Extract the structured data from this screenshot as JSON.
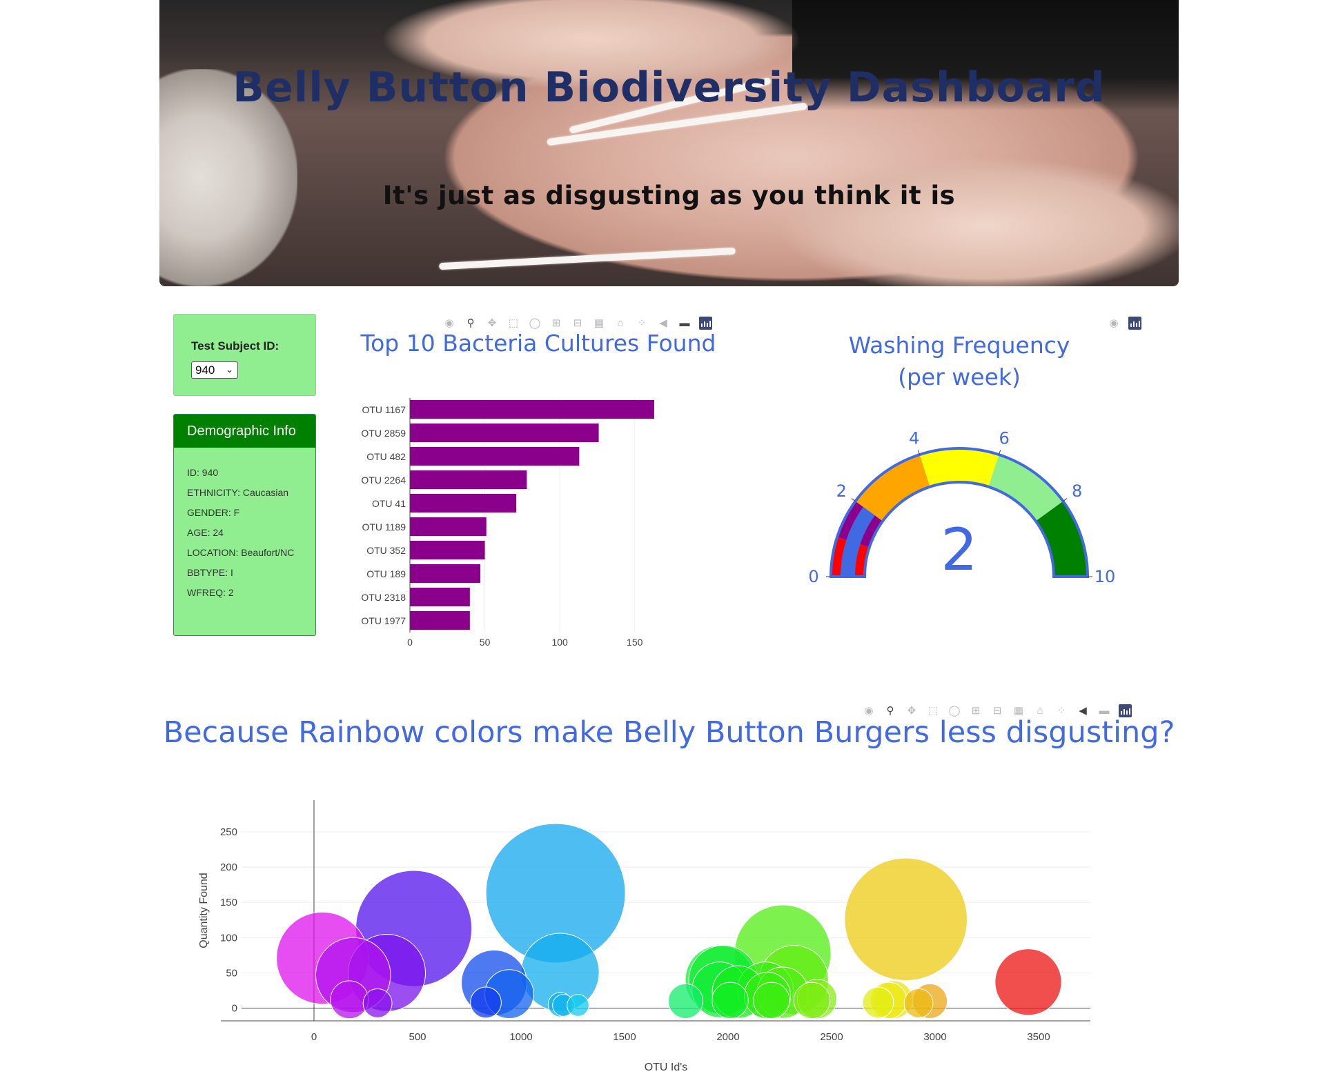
{
  "hero": {
    "title": "Belly Button Biodiversity Dashboard",
    "subtitle": "It's just as disgusting as you think it is"
  },
  "selector": {
    "label": "Test Subject ID:",
    "selected": "940"
  },
  "demographics": {
    "header": "Demographic Info",
    "lines": [
      "ID: 940",
      "ETHNICITY: Caucasian",
      "GENDER: F",
      "AGE: 24",
      "LOCATION: Beaufort/NC",
      "BBTYPE: I",
      "WFREQ: 2"
    ]
  },
  "colors": {
    "title_blue": "#4169e1",
    "bar": "#8b008b",
    "panel_green": "#90ee90",
    "header_green": "#008000"
  },
  "chart_data": [
    {
      "type": "bar",
      "orientation": "horizontal",
      "title": "Top 10 Bacteria Cultures Found",
      "categories": [
        "OTU 1167",
        "OTU 2859",
        "OTU 482",
        "OTU 2264",
        "OTU 41",
        "OTU 1189",
        "OTU 352",
        "OTU 189",
        "OTU 2318",
        "OTU 1977"
      ],
      "values": [
        163,
        126,
        113,
        78,
        71,
        51,
        50,
        47,
        40,
        40
      ],
      "xlim": [
        0,
        175
      ],
      "xticks": [
        0,
        50,
        100,
        150
      ],
      "grid": true,
      "color": "#8b008b"
    },
    {
      "type": "gauge",
      "title_lines": [
        "Washing Frequency",
        "(per week)"
      ],
      "value": 2,
      "range": [
        0,
        10
      ],
      "ticks": [
        0,
        2,
        4,
        6,
        8,
        10
      ],
      "steps": [
        {
          "range": [
            0,
            1
          ],
          "color": "#ff0000"
        },
        {
          "range": [
            1,
            2
          ],
          "color": "#8b008b"
        },
        {
          "range": [
            2,
            4
          ],
          "color": "#ffa500"
        },
        {
          "range": [
            4,
            6
          ],
          "color": "#ffff00"
        },
        {
          "range": [
            6,
            8
          ],
          "color": "#90ee90"
        },
        {
          "range": [
            8,
            10
          ],
          "color": "#008000"
        }
      ],
      "bar_color": "#4169e1"
    },
    {
      "type": "scatter",
      "mode": "bubble",
      "title": "Because Rainbow colors make Belly Button Burgers less disgusting?",
      "xlabel": "OTU Id's",
      "ylabel": "Quantity Found",
      "xlim": [
        -350,
        3750
      ],
      "ylim": [
        -18,
        295
      ],
      "xticks": [
        0,
        500,
        1000,
        1500,
        2000,
        2500,
        3000,
        3500
      ],
      "yticks": [
        0,
        50,
        100,
        150,
        200,
        250
      ],
      "grid": true,
      "points": [
        {
          "x": 41,
          "y": 71
        },
        {
          "x": 189,
          "y": 47
        },
        {
          "x": 171,
          "y": 12
        },
        {
          "x": 352,
          "y": 50
        },
        {
          "x": 307,
          "y": 7
        },
        {
          "x": 482,
          "y": 113
        },
        {
          "x": 830,
          "y": 8
        },
        {
          "x": 870,
          "y": 36
        },
        {
          "x": 943,
          "y": 20
        },
        {
          "x": 1167,
          "y": 163
        },
        {
          "x": 1189,
          "y": 51
        },
        {
          "x": 1190,
          "y": 5
        },
        {
          "x": 1205,
          "y": 4
        },
        {
          "x": 1275,
          "y": 4
        },
        {
          "x": 1795,
          "y": 10
        },
        {
          "x": 1960,
          "y": 40
        },
        {
          "x": 1977,
          "y": 40
        },
        {
          "x": 1960,
          "y": 26
        },
        {
          "x": 2010,
          "y": 11
        },
        {
          "x": 2050,
          "y": 23
        },
        {
          "x": 2180,
          "y": 26
        },
        {
          "x": 2190,
          "y": 18
        },
        {
          "x": 2210,
          "y": 11
        },
        {
          "x": 2264,
          "y": 78
        },
        {
          "x": 2264,
          "y": 22
        },
        {
          "x": 2318,
          "y": 40
        },
        {
          "x": 2405,
          "y": 11
        },
        {
          "x": 2430,
          "y": 13
        },
        {
          "x": 2725,
          "y": 8
        },
        {
          "x": 2775,
          "y": 11
        },
        {
          "x": 2800,
          "y": 12
        },
        {
          "x": 2859,
          "y": 126
        },
        {
          "x": 2920,
          "y": 7
        },
        {
          "x": 2975,
          "y": 10
        },
        {
          "x": 3450,
          "y": 37
        }
      ]
    }
  ]
}
